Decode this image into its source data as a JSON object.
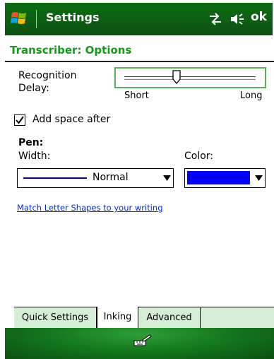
{
  "titlebar": {
    "title": "Settings",
    "ok_label": "ok",
    "start_icon": "windows-flag-icon",
    "connectivity_icon": "connectivity-icon",
    "volume_icon": "volume-icon"
  },
  "subtitle": "Transcriber: Options",
  "recognition": {
    "label_line1": "Recognition",
    "label_line2": "Delay:",
    "min_label": "Short",
    "max_label": "Long",
    "slider_value": 0.4
  },
  "add_space": {
    "label": "Add space after",
    "checked": true
  },
  "pen": {
    "heading": "Pen:",
    "width_label": "Width:",
    "width_value": "Normal",
    "color_label": "Color:",
    "color_value": "#0000ff"
  },
  "link_text": "Match Letter Shapes to your writing",
  "tabs": [
    {
      "label": "Quick Settings",
      "active": false
    },
    {
      "label": "Inking",
      "active": true
    },
    {
      "label": "Advanced",
      "active": false
    }
  ],
  "bottombar": {
    "sip_icon": "keyboard-pen-icon"
  },
  "colors": {
    "titlebar": "#0e5f14",
    "subtitle": "#169a1a",
    "link": "#0a2bd6",
    "tab_strip": "#d6edd6",
    "pen_color": "#0000ff"
  }
}
